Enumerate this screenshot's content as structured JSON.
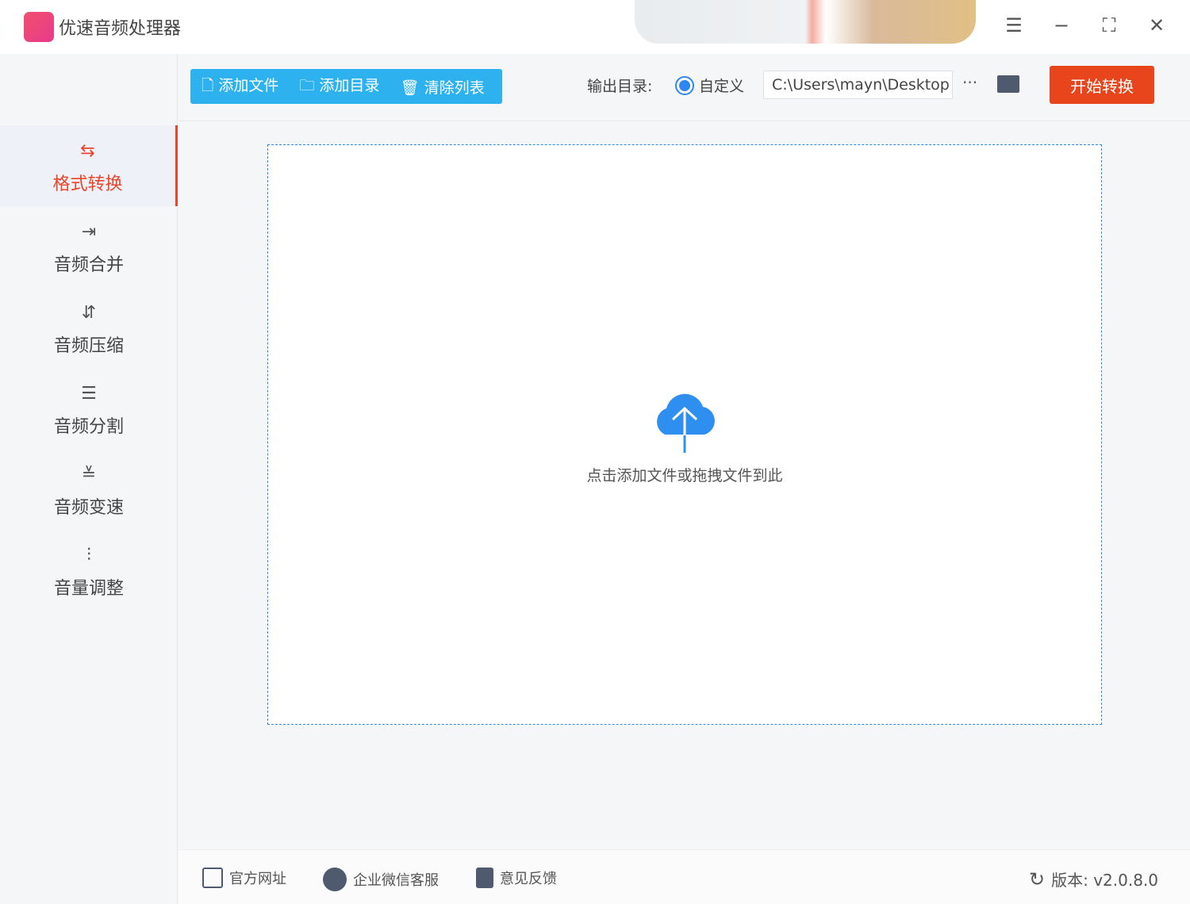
{
  "app": {
    "title": "优速音频处理器"
  },
  "toolbar": {
    "add_file": "添加文件",
    "add_folder": "添加目录",
    "clear_list": "清除列表",
    "output_label": "输出目录:",
    "radio_custom": "自定义",
    "output_path": "C:\\Users\\mayn\\Desktop",
    "more": "···",
    "start": "开始转换"
  },
  "sidebar": {
    "items": [
      {
        "label": "格式转换"
      },
      {
        "label": "音频合并"
      },
      {
        "label": "音频压缩"
      },
      {
        "label": "音频分割"
      },
      {
        "label": "音频变速"
      },
      {
        "label": "音量调整"
      }
    ]
  },
  "dropzone": {
    "hint": "点击添加文件或拖拽文件到此"
  },
  "footer": {
    "website": "官方网址",
    "wechat": "企业微信客服",
    "feedback": "意见反馈",
    "version": "版本: v2.0.8.0"
  },
  "colors": {
    "accent": "#2db1ef",
    "start": "#e9451d",
    "active": "#e9452a"
  }
}
